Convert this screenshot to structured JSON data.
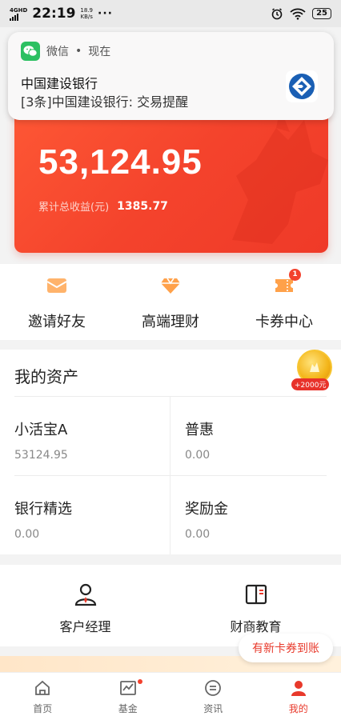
{
  "status_bar": {
    "network": "4GHD",
    "time": "22:19",
    "speed_value": "18.9",
    "speed_unit": "KB/s",
    "more": "···",
    "battery": "25"
  },
  "notification": {
    "app_name": "微信",
    "separator": "•",
    "when": "现在",
    "title": "中国建设银行",
    "body": "[3条]中国建设银行: 交易提醒"
  },
  "hero": {
    "balance": "53,124.95",
    "earnings_label": "累计总收益(元)",
    "earnings_value": "1385.77"
  },
  "quick_actions": [
    {
      "label": "邀请好友",
      "icon": "envelope-icon"
    },
    {
      "label": "高端理财",
      "icon": "diamond-icon"
    },
    {
      "label": "卡券中心",
      "icon": "coupon-icon",
      "badge": "1"
    }
  ],
  "assets": {
    "title": "我的资产",
    "coin_tag": "+2000元",
    "items": [
      {
        "name": "小活宝A",
        "value": "53124.95"
      },
      {
        "name": "普惠",
        "value": "0.00"
      },
      {
        "name": "银行精选",
        "value": "0.00"
      },
      {
        "name": "奖励金",
        "value": "0.00"
      }
    ]
  },
  "services": [
    {
      "label": "客户经理",
      "icon": "manager-icon"
    },
    {
      "label": "财商教育",
      "icon": "book-icon"
    }
  ],
  "tooltip": "有新卡券到账",
  "tabs": [
    {
      "label": "首页",
      "icon": "home-icon"
    },
    {
      "label": "基金",
      "icon": "chart-icon"
    },
    {
      "label": "资讯",
      "icon": "news-icon"
    },
    {
      "label": "我的",
      "icon": "profile-icon"
    }
  ],
  "colors": {
    "accent": "#e8392b",
    "hero_gradient_start": "#ff5a36",
    "hero_gradient_end": "#ef3a28",
    "wechat_green": "#2cc062"
  }
}
